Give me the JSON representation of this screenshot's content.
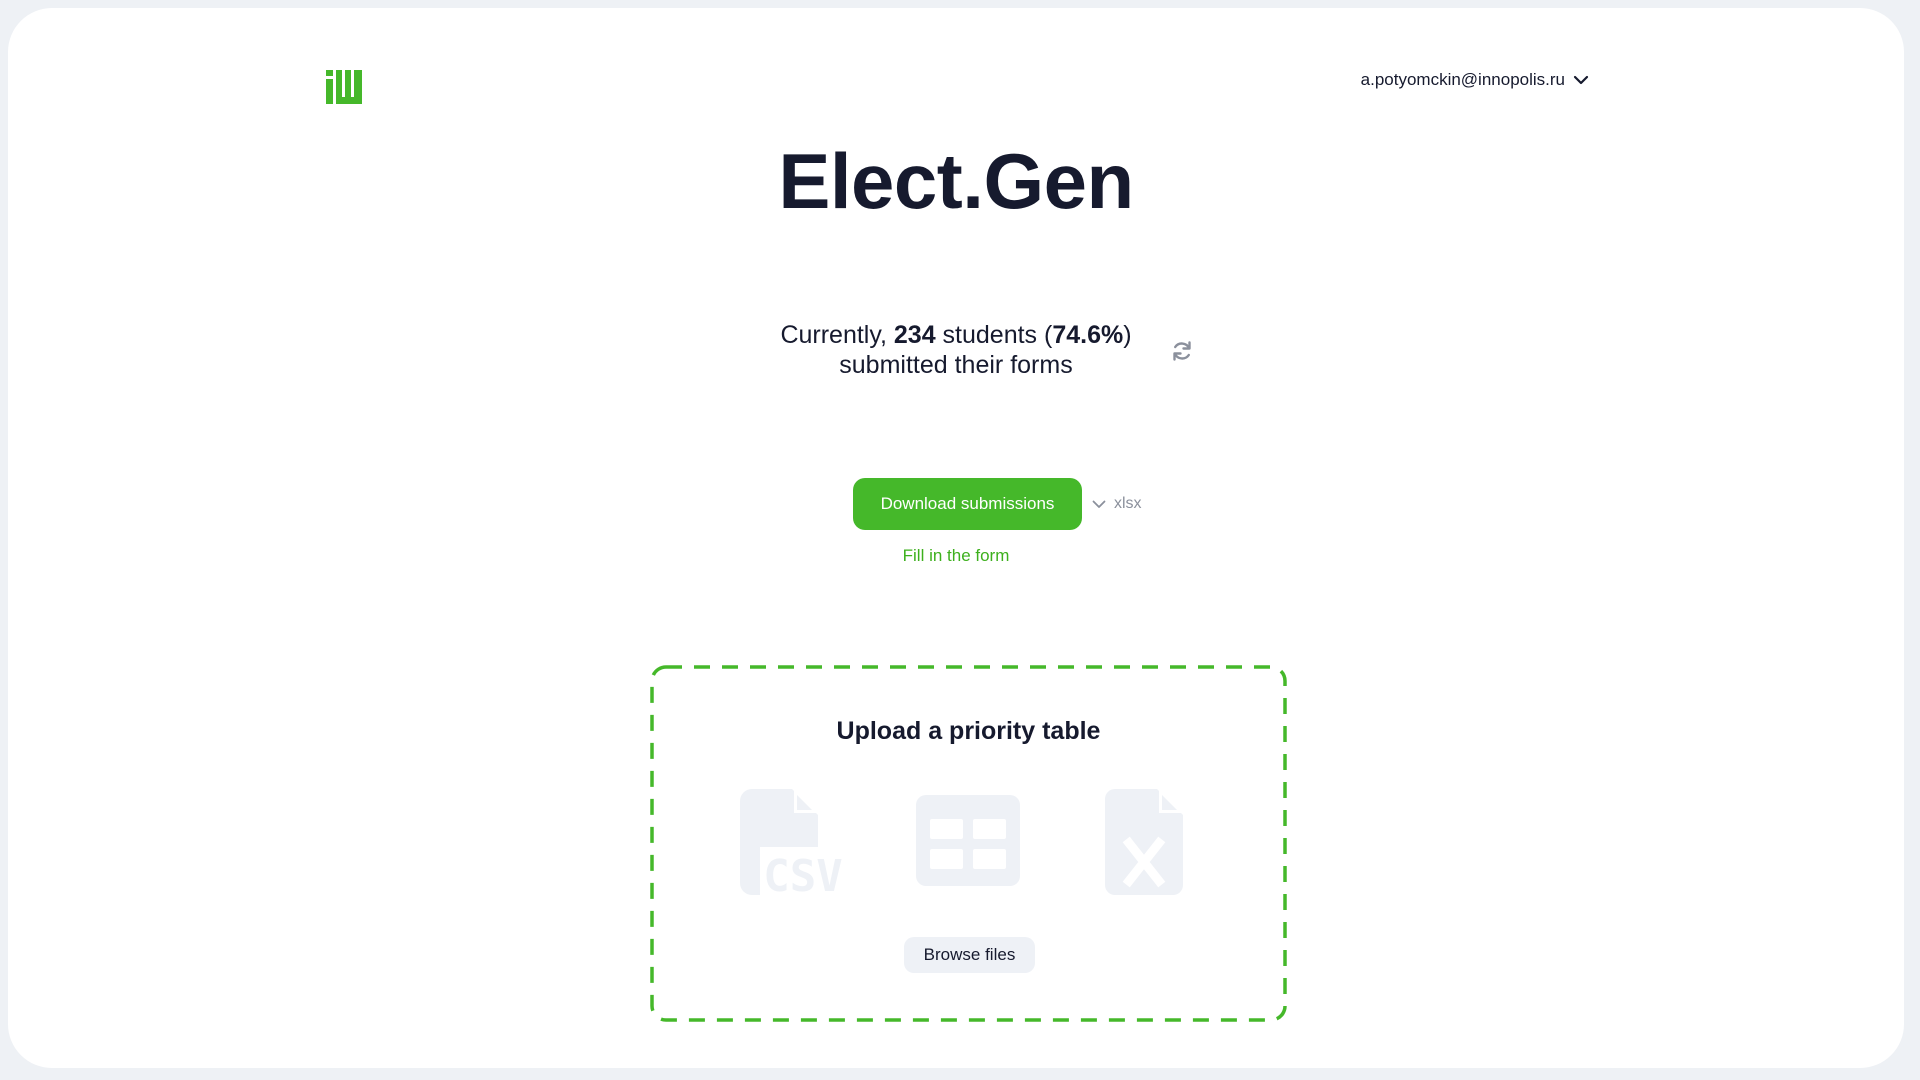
{
  "user": {
    "email": "a.potyomckin@innopolis.ru"
  },
  "app": {
    "title": "Elect.Gen"
  },
  "stats": {
    "prefix": "Currently, ",
    "count": "234",
    "middle": " students (",
    "percent": "74.6%",
    "suffix": ")",
    "line2": "submitted their forms"
  },
  "actions": {
    "download_label": "Download submissions",
    "format_value": "xlsx",
    "fill_link": "Fill in the form"
  },
  "upload": {
    "title": "Upload a priority table",
    "browse_label": "Browse files",
    "file_types": [
      "csv-file-icon",
      "table-icon",
      "excel-file-icon"
    ]
  },
  "colors": {
    "accent": "#45b82a",
    "text": "#161a2e",
    "muted": "#8b909c",
    "icon_placeholder": "#eef1f6"
  }
}
